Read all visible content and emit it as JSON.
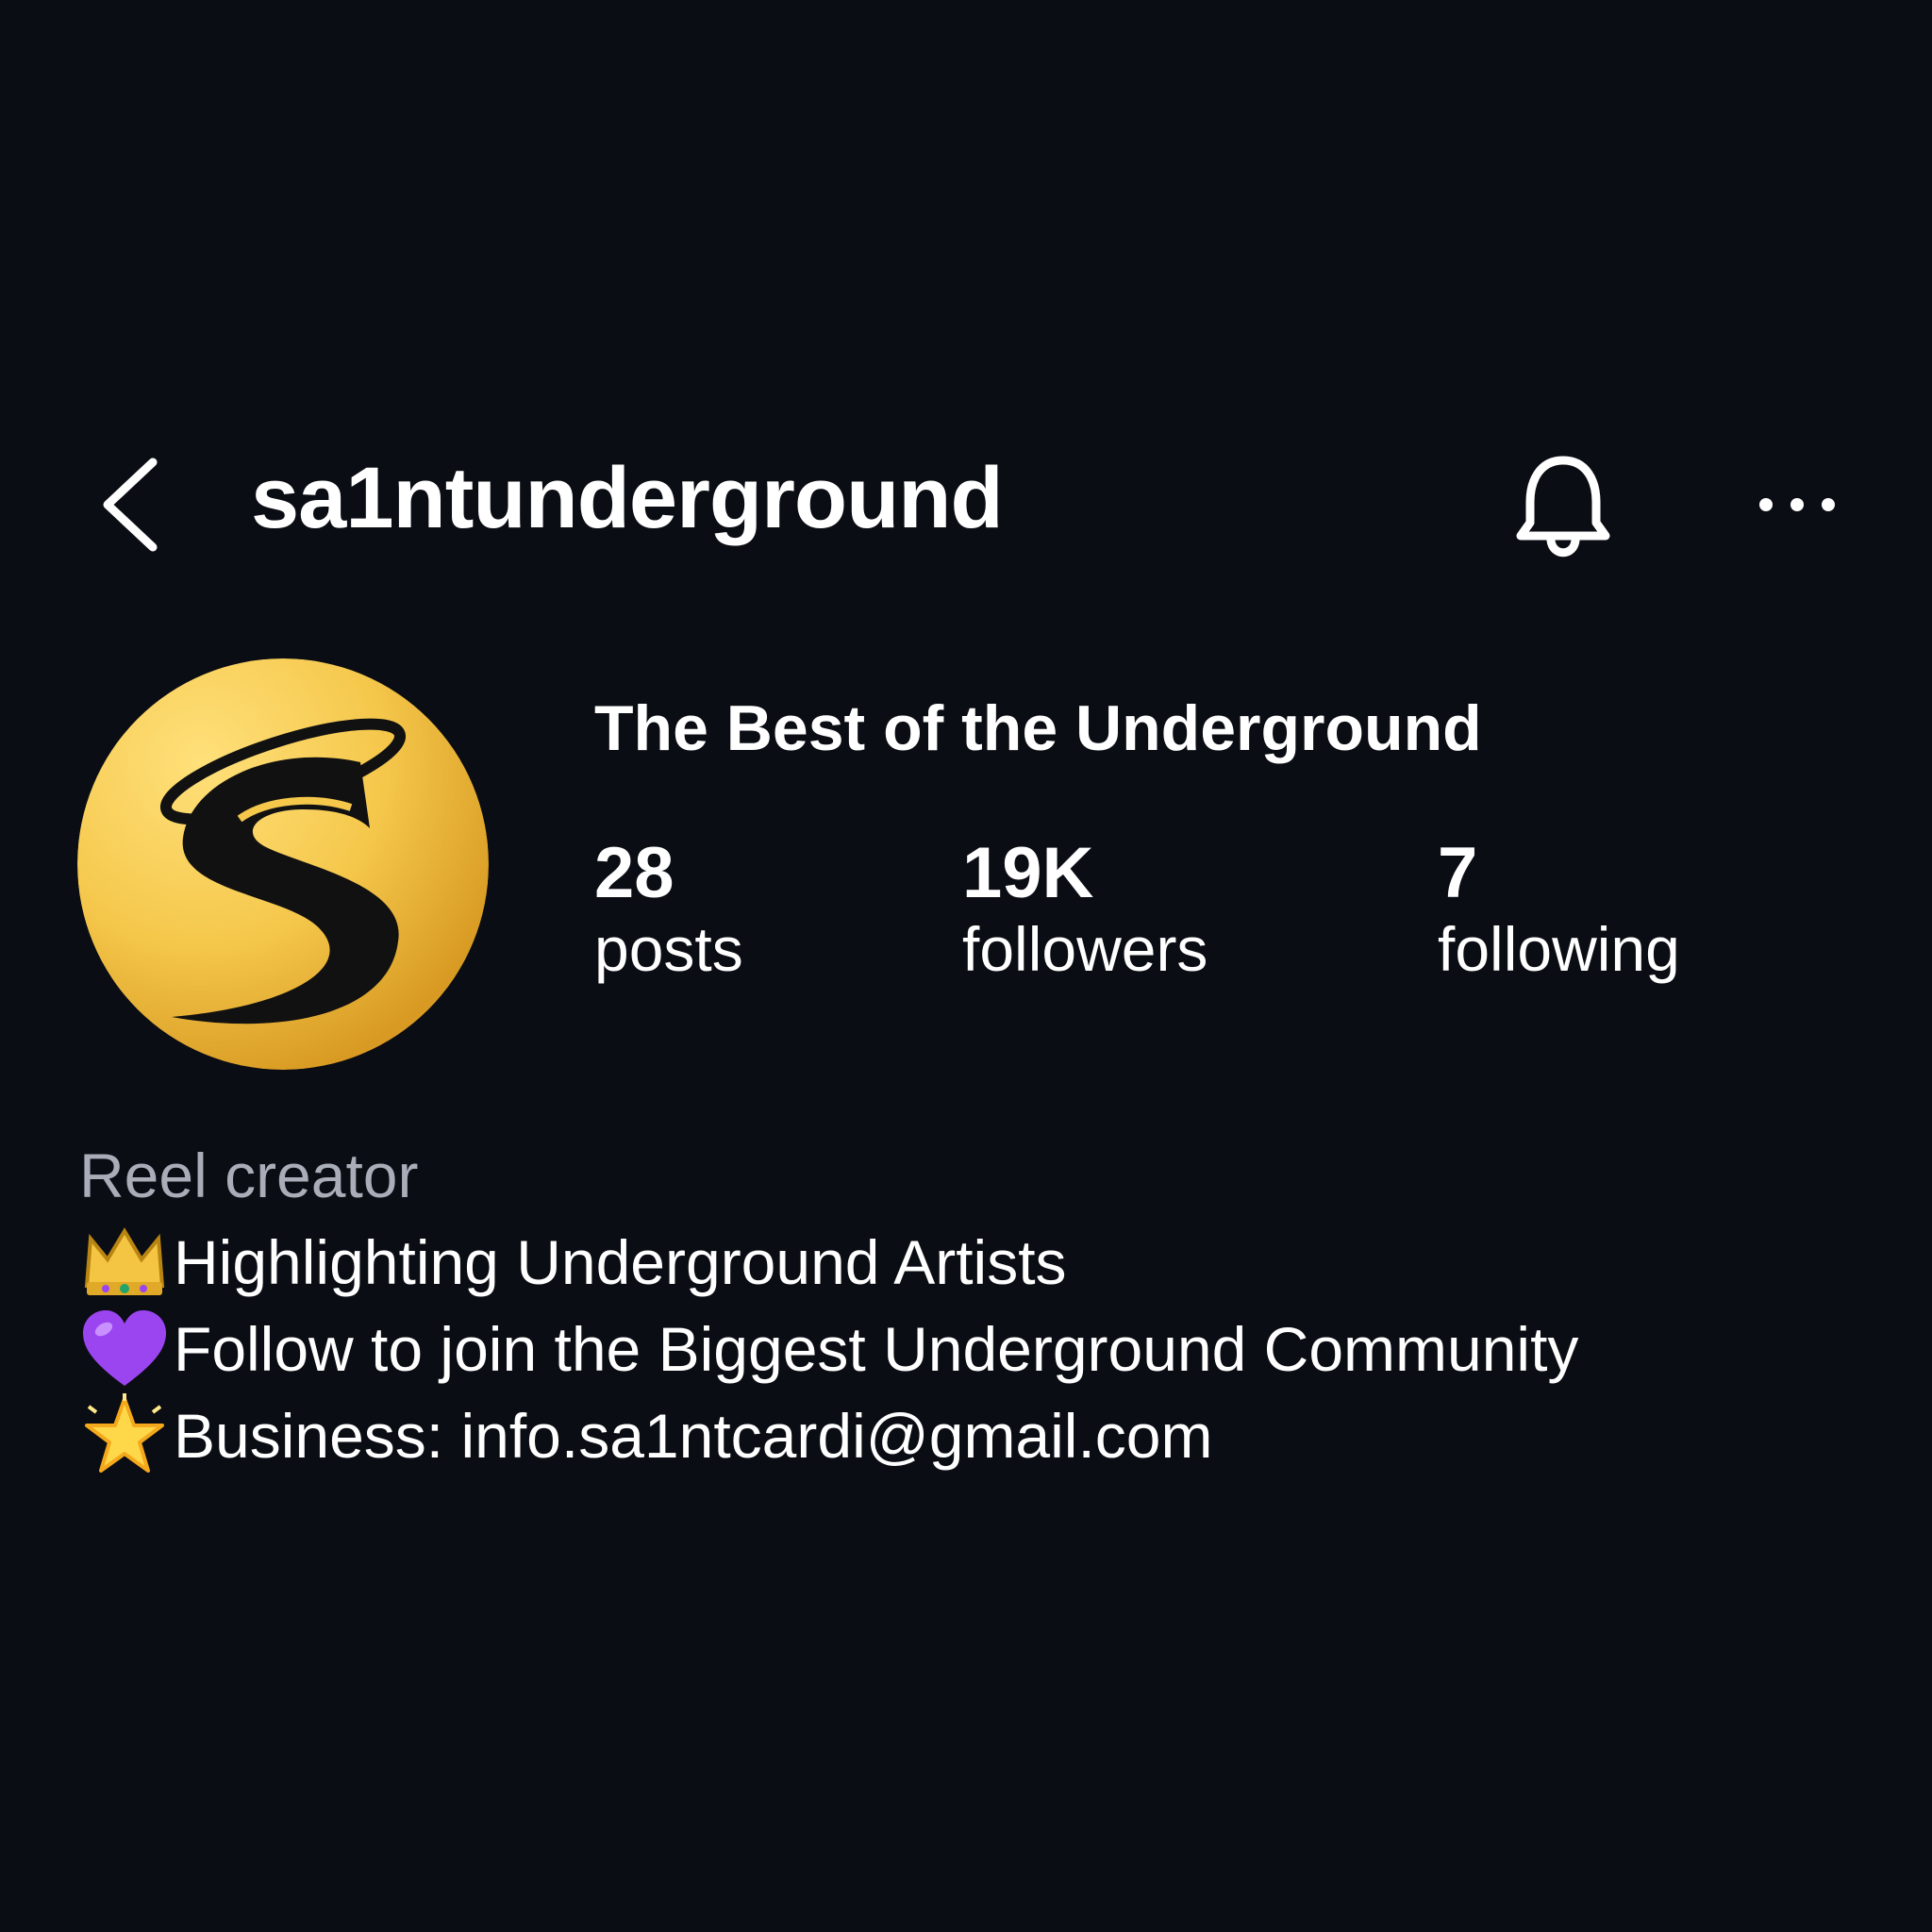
{
  "header": {
    "username": "sa1ntunderground",
    "back_icon": "chevron-left-icon",
    "notification_icon": "bell-icon",
    "more_icon": "more-horizontal-icon"
  },
  "profile": {
    "display_name": "The Best of the Underground",
    "avatar": "gold-s-logo",
    "stats": {
      "posts": {
        "value": "28",
        "label": "posts"
      },
      "followers": {
        "value": "19K",
        "label": "followers"
      },
      "following": {
        "value": "7",
        "label": "following"
      }
    }
  },
  "bio": {
    "category": "Reel creator",
    "lines": [
      {
        "emoji": "crown-icon",
        "text": "Highlighting Underground Artists"
      },
      {
        "emoji": "purple-heart-icon",
        "text": "Follow to join the Biggest Underground Community"
      },
      {
        "emoji": "glowing-star-icon",
        "text": "Business: info.sa1ntcardi@gmail.com"
      }
    ]
  },
  "colors": {
    "background": "#0b0d14",
    "text": "#ffffff",
    "muted_text": "#a9adb8",
    "avatar_gold": "#f5c84c",
    "heart_purple": "#9b45f0"
  }
}
